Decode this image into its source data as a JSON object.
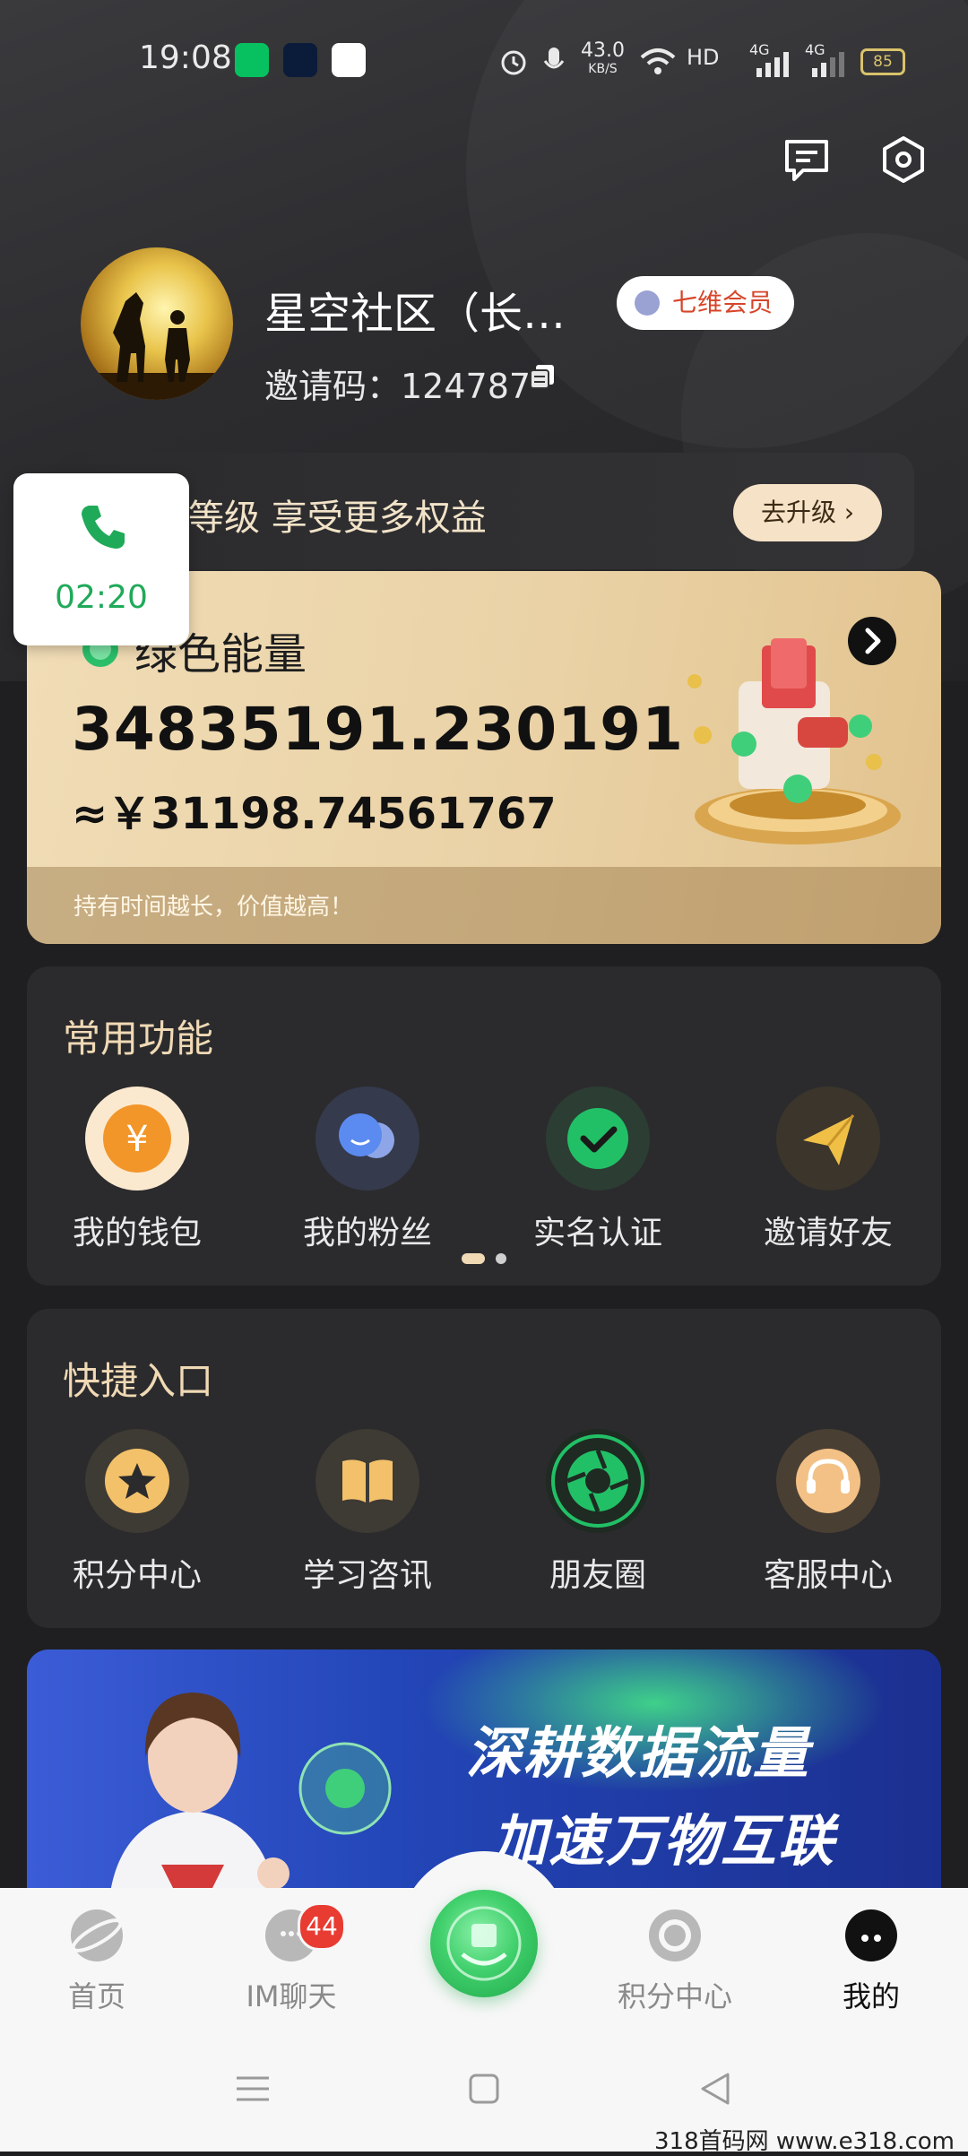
{
  "status_bar": {
    "time": "19:08",
    "net_speed": "43.0",
    "net_unit": "KB/S",
    "hd": "HD",
    "sig1": "4G",
    "sig2": "4G",
    "battery": "85",
    "app_icons": [
      "wechat-icon",
      "app-icon",
      "qq-icon"
    ]
  },
  "header": {
    "message_icon": "message-icon",
    "settings_icon": "settings-hex-icon"
  },
  "profile": {
    "name": "星空社区（长…",
    "member_badge": "七维会员",
    "invite_label": "邀请码：124787"
  },
  "member_bar": {
    "text": "会员等级  享受更多权益",
    "upgrade_label": "去升级 ›"
  },
  "call": {
    "duration": "02:20"
  },
  "energy": {
    "title": "绿色能量",
    "value": "34835191.230191",
    "rmb": "≈￥31198.74561767",
    "footer": "持有时间越长，价值越高！"
  },
  "common": {
    "title": "常用功能",
    "items": [
      {
        "label": "我的钱包",
        "icon": "wallet-icon"
      },
      {
        "label": "我的粉丝",
        "icon": "fans-icon"
      },
      {
        "label": "实名认证",
        "icon": "verify-icon"
      },
      {
        "label": "邀请好友",
        "icon": "invite-icon"
      }
    ]
  },
  "quick": {
    "title": "快捷入口",
    "items": [
      {
        "label": "积分中心",
        "icon": "star-icon"
      },
      {
        "label": "学习咨讯",
        "icon": "book-icon"
      },
      {
        "label": "朋友圈",
        "icon": "moments-icon"
      },
      {
        "label": "客服中心",
        "icon": "headset-icon"
      }
    ]
  },
  "banner": {
    "line1": "深耕数据流量",
    "line2": "加速万物互联"
  },
  "tabbar": {
    "items": [
      {
        "label": "首页",
        "icon": "planet-icon"
      },
      {
        "label": "IM聊天",
        "icon": "chat-icon",
        "badge": "44"
      },
      {
        "label": "",
        "icon": "center-app-icon"
      },
      {
        "label": "积分中心",
        "icon": "points-icon"
      },
      {
        "label": "我的",
        "icon": "profile-icon"
      }
    ]
  },
  "watermark": "318首码网 www.e318.com"
}
